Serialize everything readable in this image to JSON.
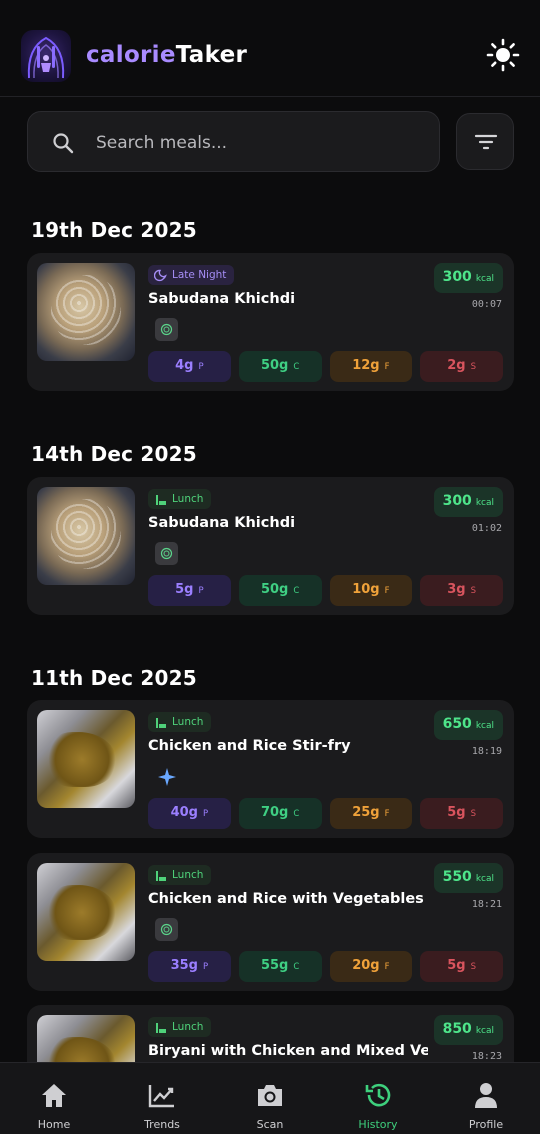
{
  "app": {
    "brand_part1": "calorie",
    "brand_part2": "Taker"
  },
  "search": {
    "placeholder": "Search meals..."
  },
  "groups": [
    {
      "date": "19th Dec 2025",
      "meals": [
        {
          "meal_type": "Late Night",
          "name": "Sabudana Khichdi",
          "kcal": "300",
          "kcal_unit": "kcal",
          "time": "00:07",
          "macros": {
            "protein": "4g",
            "carbs": "50g",
            "fat": "12g",
            "sugar": "2g"
          }
        }
      ]
    },
    {
      "date": "14th Dec 2025",
      "meals": [
        {
          "meal_type": "Lunch",
          "name": "Sabudana Khichdi",
          "kcal": "300",
          "kcal_unit": "kcal",
          "time": "01:02",
          "macros": {
            "protein": "5g",
            "carbs": "50g",
            "fat": "10g",
            "sugar": "3g"
          }
        }
      ]
    },
    {
      "date": "11th Dec 2025",
      "meals": [
        {
          "meal_type": "Lunch",
          "name": "Chicken and Rice Stir-fry",
          "kcal": "650",
          "kcal_unit": "kcal",
          "time": "18:19",
          "macros": {
            "protein": "40g",
            "carbs": "70g",
            "fat": "25g",
            "sugar": "5g"
          }
        },
        {
          "meal_type": "Lunch",
          "name": "Chicken and Rice with Vegetables",
          "kcal": "550",
          "kcal_unit": "kcal",
          "time": "18:21",
          "macros": {
            "protein": "35g",
            "carbs": "55g",
            "fat": "20g",
            "sugar": "5g"
          }
        },
        {
          "meal_type": "Lunch",
          "name": "Biryani with Chicken and Mixed Veg...",
          "kcal": "850",
          "kcal_unit": "kcal",
          "time": "18:23"
        }
      ]
    }
  ],
  "macro_letters": {
    "protein": "P",
    "carbs": "C",
    "fat": "F",
    "sugar": "S"
  },
  "nav": [
    {
      "label": "Home",
      "icon": "home-icon"
    },
    {
      "label": "Trends",
      "icon": "chart-icon"
    },
    {
      "label": "Scan",
      "icon": "camera-icon"
    },
    {
      "label": "History",
      "icon": "history-icon",
      "active": true
    },
    {
      "label": "Profile",
      "icon": "person-icon"
    }
  ],
  "colors": {
    "accent": "#a98bff",
    "active": "#3ed07d",
    "kcal": "#4ee58a",
    "protein": "#9b7fff",
    "carbs": "#3fcf83",
    "fat": "#f0a23a",
    "sugar": "#d9545e"
  }
}
